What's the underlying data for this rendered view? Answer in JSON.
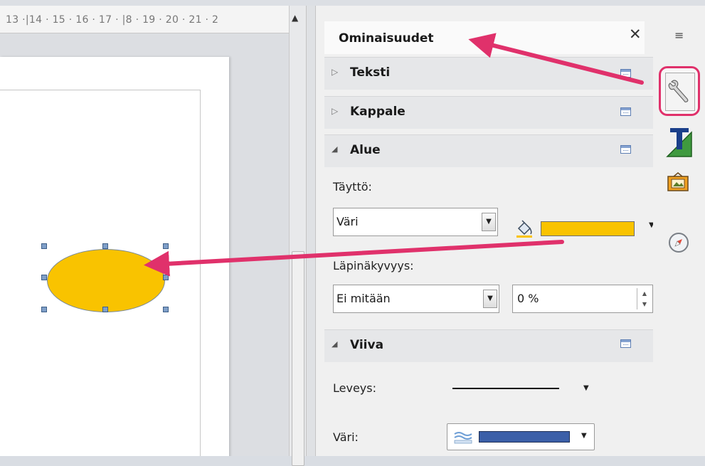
{
  "ruler": {
    "numbers": "13 ·|14 · 15 · 16 · 17 · |8 · 19 · 20 · 21 · 2"
  },
  "panel": {
    "title": "Ominaisuudet",
    "close_symbol": "✕",
    "sections": {
      "text": {
        "title": "Teksti",
        "expanded": false
      },
      "paragraph": {
        "title": "Kappale",
        "expanded": false
      },
      "area": {
        "title": "Alue",
        "expanded": true,
        "fill_label": "Täyttö:",
        "fill_type_value": "Väri",
        "fill_color": "#f9c300",
        "transparency_label": "Läpinäkyvyys:",
        "transparency_value": "Ei mitään",
        "transparency_percent": "0 %"
      },
      "line": {
        "title": "Viiva",
        "expanded": true,
        "width_label": "Leveys:",
        "color_label": "Väri:",
        "line_color": "#3b5fa8"
      }
    }
  },
  "shape": {
    "fill_color": "#f9c300"
  },
  "annotation": {
    "arrow_color": "#e0316b"
  }
}
